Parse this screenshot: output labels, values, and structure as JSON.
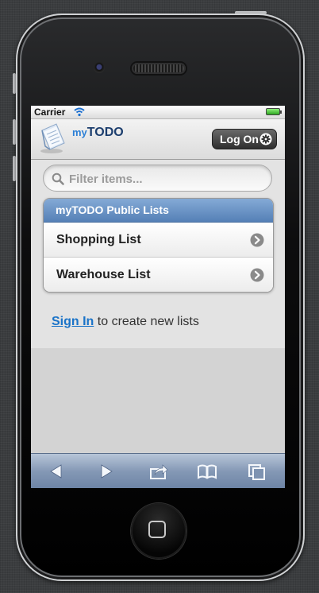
{
  "device": {
    "carrier": "Carrier"
  },
  "app": {
    "logo_prefix": "my",
    "logo_name": "TODO",
    "logon_label": "Log On"
  },
  "search": {
    "placeholder": "Filter items..."
  },
  "lists": {
    "header": "myTODO Public Lists",
    "items": [
      {
        "label": "Shopping List"
      },
      {
        "label": "Warehouse List"
      }
    ]
  },
  "signin": {
    "link": "Sign In",
    "text": " to create new lists"
  },
  "toolbar": {
    "buttons": [
      "back-icon",
      "forward-icon",
      "share-icon",
      "bookmarks-icon",
      "tabs-icon"
    ]
  },
  "colors": {
    "header_blue": "#5580b6",
    "link_blue": "#1a73c8"
  }
}
